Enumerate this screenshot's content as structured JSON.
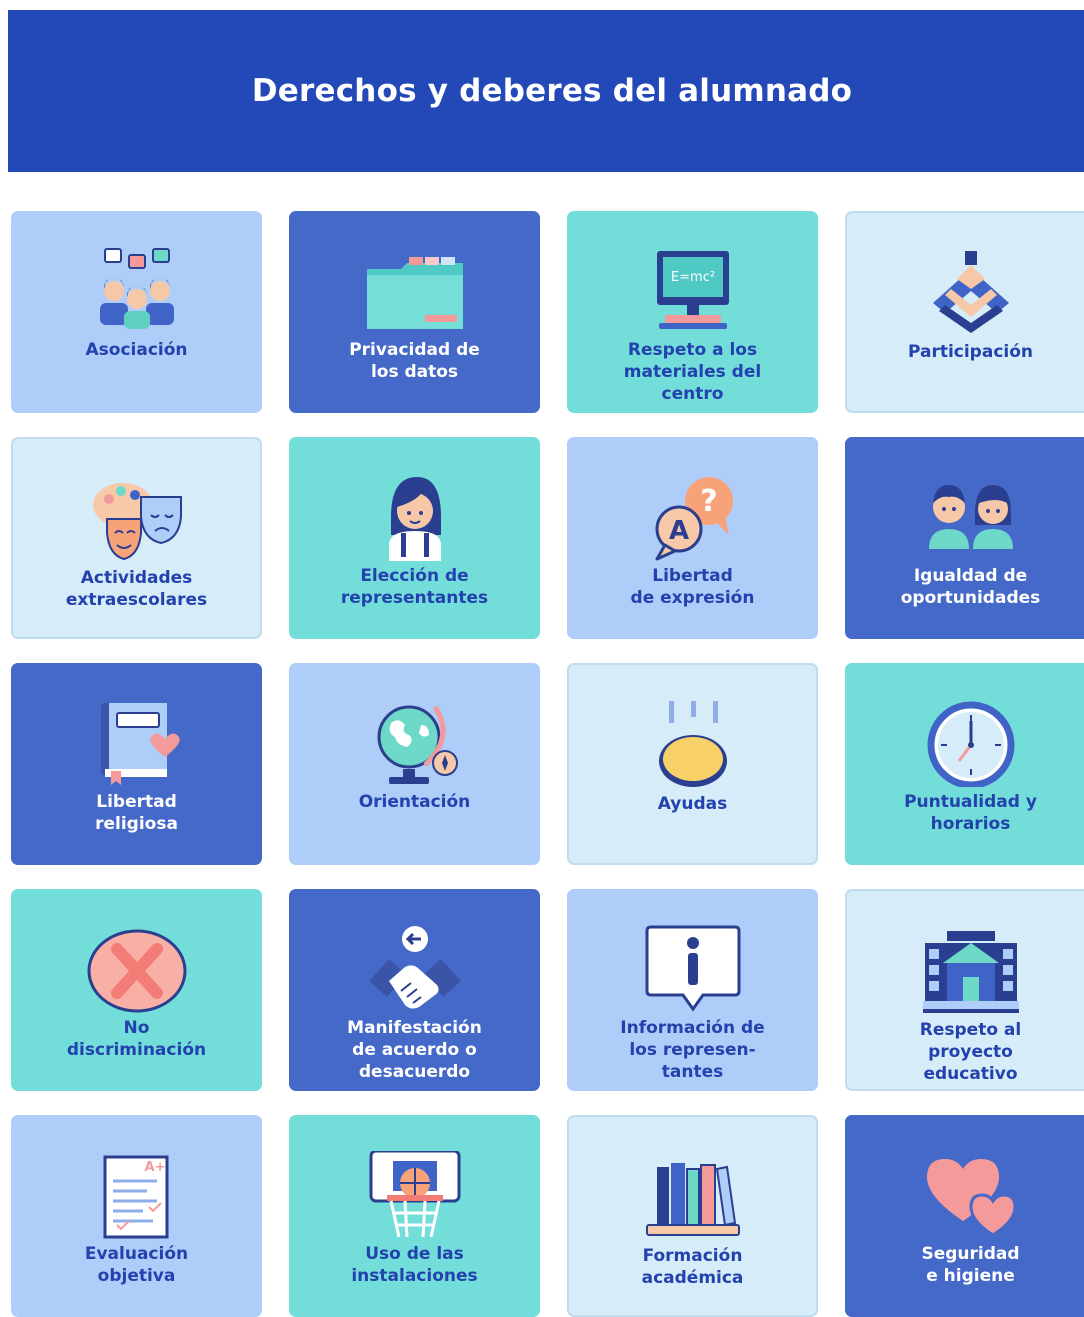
{
  "header": {
    "title": "Derechos y deberes del alumnado"
  },
  "cards": [
    {
      "label": "Asociación"
    },
    {
      "label": "Privacidad de\nlos datos"
    },
    {
      "label": "Respeto a los\nmateriales del\ncentro"
    },
    {
      "label": "Participación"
    },
    {
      "label": "Actividades\nextraescolares"
    },
    {
      "label": "Elección de\nrepresentantes"
    },
    {
      "label": "Libertad\nde expresión"
    },
    {
      "label": "Igualdad de\noportunidades"
    },
    {
      "label": "Libertad\nreligiosa"
    },
    {
      "label": "Orientación"
    },
    {
      "label": "Ayudas"
    },
    {
      "label": "Puntualidad y\nhorarios"
    },
    {
      "label": "No\ndiscriminación"
    },
    {
      "label": "Manifestación\nde acuerdo o\ndesacuerdo"
    },
    {
      "label": "Información de\nlos represen-\ntantes"
    },
    {
      "label": "Respeto al\nproyecto\neducativo"
    },
    {
      "label": "Evaluación\nobjetiva"
    },
    {
      "label": "Uso de las\ninstalaciones"
    },
    {
      "label": "Formación\nacadémica"
    },
    {
      "label": "Seguridad\ne higiene"
    }
  ],
  "icons": {
    "formula_text": "E=mc²",
    "letter_a": "A",
    "question_mark": "?",
    "grade_text": "A+",
    "info_letter": "i"
  },
  "colors": {
    "header_bg": "#2348b8",
    "card_light": "#d6ecf8",
    "card_blue": "#aecdf8",
    "card_teal": "#73ddd9",
    "card_dark": "#4569c9",
    "label_text": "#2442ae",
    "label_text_on_dark": "#ffffff"
  }
}
